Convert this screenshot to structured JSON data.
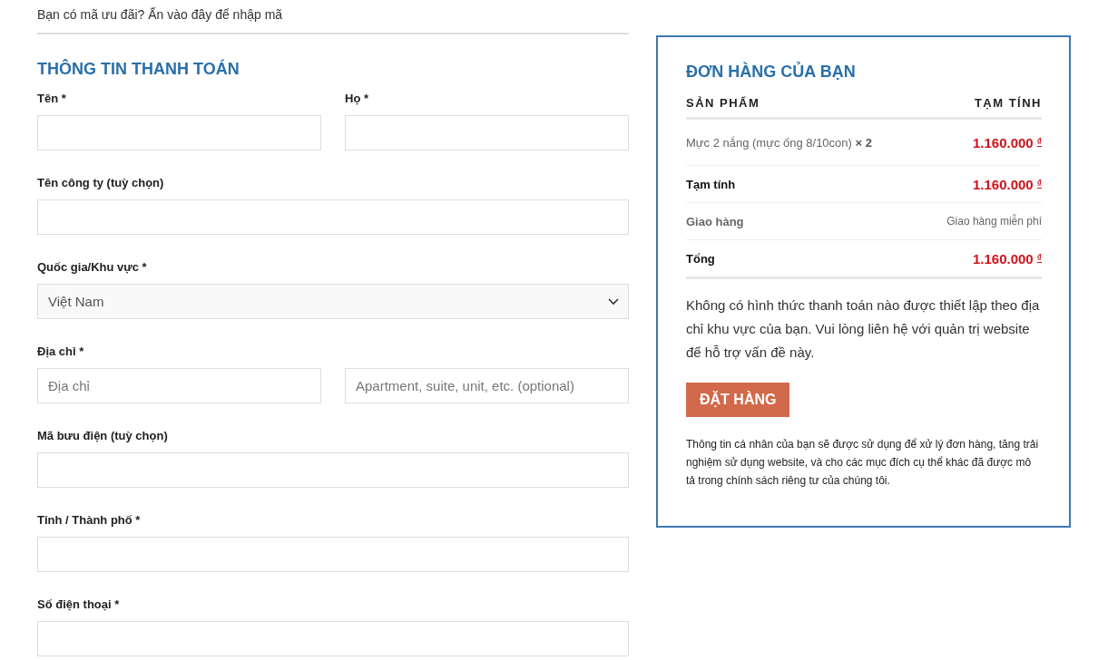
{
  "coupon_notice": "Bạn có mã ưu đãi? Ấn vào đây để nhập mã",
  "billing": {
    "title": "THÔNG TIN THANH TOÁN",
    "rows": [
      [
        {
          "label": "Tên *",
          "kind": "text"
        },
        {
          "label": "Họ *",
          "kind": "text"
        }
      ],
      [
        {
          "label": "Tên công ty (tuỳ chọn)",
          "kind": "text"
        }
      ],
      [
        {
          "label": "Quốc gia/Khu vực *",
          "kind": "select",
          "value": "Việt Nam"
        }
      ],
      [
        {
          "label": "Địa chỉ *",
          "kind": "text",
          "placeholder": "Địa chỉ"
        },
        {
          "kind": "text",
          "placeholder": "Apartment, suite, unit, etc. (optional)"
        }
      ],
      [
        {
          "label": "Mã bưu điện (tuỳ chọn)",
          "kind": "text"
        }
      ],
      [
        {
          "label": "Tỉnh / Thành phố *",
          "kind": "text"
        }
      ],
      [
        {
          "label": "Số điện thoại *",
          "kind": "text"
        }
      ]
    ]
  },
  "order": {
    "title": "ĐƠN HÀNG CỦA BẠN",
    "columns": [
      "SẢN PHẨM",
      "TẠM TÍNH"
    ],
    "items": [
      {
        "name": "Mực 2 nắng (mực ống 8/10con)",
        "quantity": "× 2",
        "amount": "1.160.000",
        "currency": "₫"
      }
    ],
    "totals": [
      {
        "label": "Tạm tính",
        "kind": "price",
        "amount": "1.160.000",
        "currency": "₫"
      },
      {
        "label": "Giao hàng",
        "kind": "text",
        "value": "Giao hàng miễn phí"
      },
      {
        "label": "Tổng",
        "kind": "price",
        "amount": "1.160.000",
        "currency": "₫"
      }
    ],
    "notice": "Không có hình thức thanh toán nào được thiết lập theo địa chỉ khu vực của bạn. Vui lòng liên hệ với quản trị website để hỗ trợ vấn đề này.",
    "button": "ĐẶT HÀNG",
    "privacy": "Thông tin cá nhân của bạn sẽ được sử dụng để xử lý đơn hàng, tăng trải nghiệm sử dụng website, và cho các mục đích cụ thể khác đã được mô tả trong chính sách riêng tư của chúng tôi."
  }
}
